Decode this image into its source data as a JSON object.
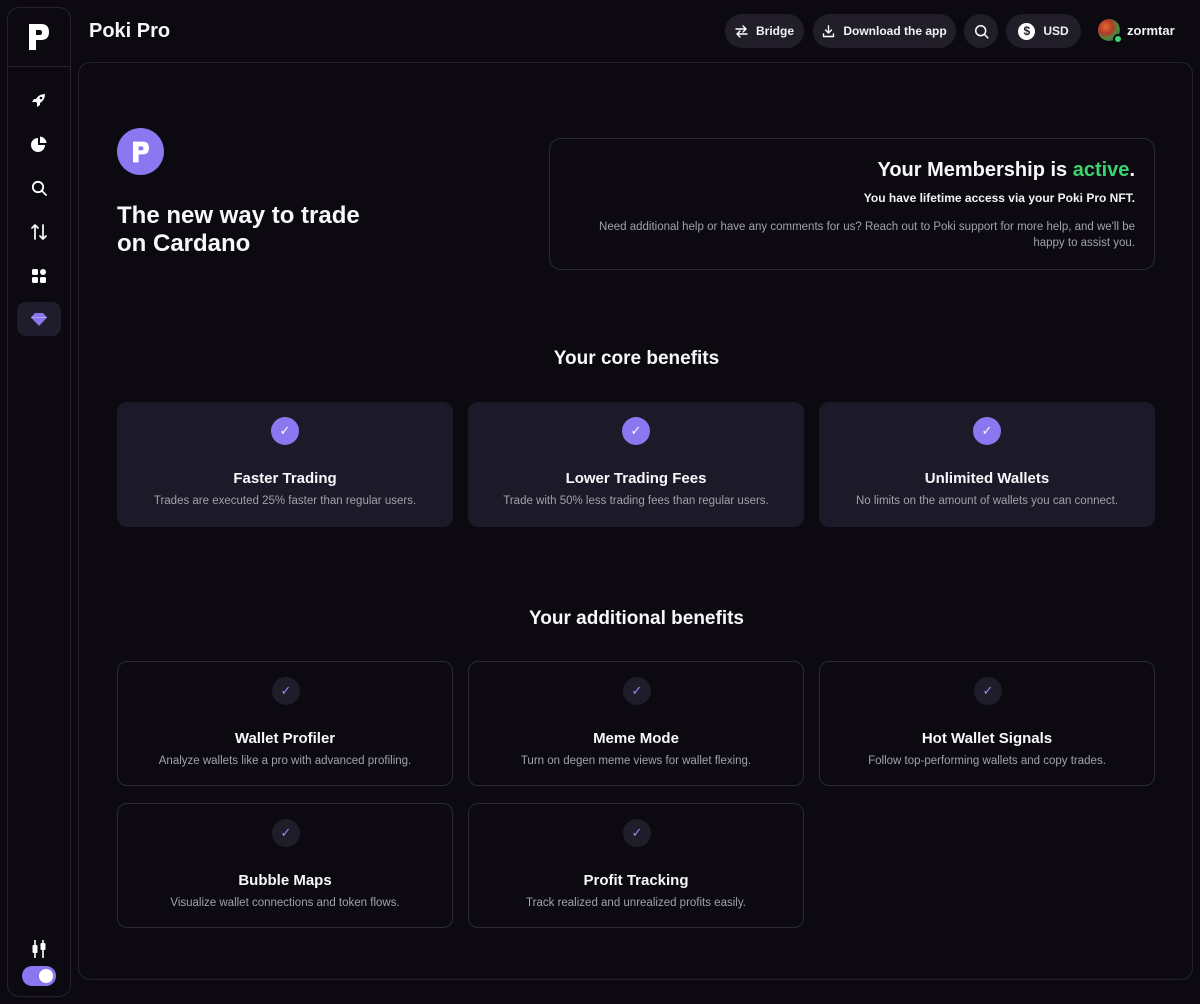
{
  "app": {
    "title": "Poki Pro"
  },
  "topbar": {
    "bridge_label": "Bridge",
    "download_label": "Download the app",
    "currency_symbol": "$",
    "currency_label": "USD",
    "username": "zormtar"
  },
  "sidebar": {
    "items": [
      {
        "name": "discover",
        "icon": "rocket-icon"
      },
      {
        "name": "portfolio",
        "icon": "pie-chart-icon"
      },
      {
        "name": "search",
        "icon": "search-icon"
      },
      {
        "name": "swap",
        "icon": "arrows-up-down-icon"
      },
      {
        "name": "apps",
        "icon": "grid-icon"
      },
      {
        "name": "pro",
        "icon": "diamond-icon",
        "active": true
      }
    ],
    "bottom_icon": "candlestick-icon",
    "toggle_on": true
  },
  "hero": {
    "headline_line1": "The new way to trade",
    "headline_line2": "on Cardano"
  },
  "membership": {
    "title_prefix": "Your Membership is ",
    "status": "active",
    "title_suffix": ".",
    "subtitle": "You have lifetime access via your Poki Pro NFT.",
    "help_text": "Need additional help or have any comments for us? Reach out to Poki support for more help, and we'll be happy to assist you."
  },
  "core": {
    "title": "Your core benefits",
    "check_glyph": "✓",
    "items": [
      {
        "title": "Faster Trading",
        "desc": "Trades are executed 25% faster than regular users."
      },
      {
        "title": "Lower Trading Fees",
        "desc": "Trade with 50% less trading fees than regular users."
      },
      {
        "title": "Unlimited Wallets",
        "desc": "No limits on the amount of wallets you can connect."
      }
    ]
  },
  "additional": {
    "title": "Your additional benefits",
    "check_glyph": "✓",
    "items": [
      {
        "title": "Wallet Profiler",
        "desc": "Analyze wallets like a pro with advanced profiling."
      },
      {
        "title": "Meme Mode",
        "desc": "Turn on degen meme views for wallet flexing."
      },
      {
        "title": "Hot Wallet Signals",
        "desc": "Follow top-performing wallets and copy trades."
      },
      {
        "title": "Bubble Maps",
        "desc": "Visualize wallet connections and token flows."
      },
      {
        "title": "Profit Tracking",
        "desc": "Track realized and unrealized profits easily."
      }
    ]
  },
  "colors": {
    "accent": "#8b78f0",
    "active_green": "#3ad56e",
    "background": "#0c0a10",
    "card": "#1c1a28"
  }
}
